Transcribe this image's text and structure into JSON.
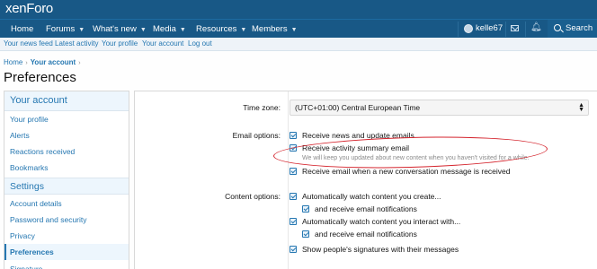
{
  "header": {
    "logo": "xenForo"
  },
  "nav": {
    "items": [
      {
        "label": "Home",
        "has_menu": false
      },
      {
        "label": "Forums",
        "has_menu": true
      },
      {
        "label": "What's new",
        "has_menu": true
      },
      {
        "label": "Media",
        "has_menu": true
      },
      {
        "label": "Resources",
        "has_menu": true
      },
      {
        "label": "Members",
        "has_menu": true
      }
    ],
    "username": "kelle67",
    "search_label": "Search"
  },
  "subnav": {
    "links": [
      "Your news feed",
      "Latest activity",
      "Your profile",
      "Your account",
      "Log out"
    ]
  },
  "breadcrumb": {
    "home": "Home",
    "current": "Your account"
  },
  "page_title": "Preferences",
  "sidebar": {
    "header": "Your account",
    "items": [
      "Your profile",
      "Alerts",
      "Reactions received",
      "Bookmarks"
    ],
    "group2": "Settings",
    "settings_items": [
      "Account details",
      "Password and security",
      "Privacy",
      "Preferences",
      "Signature"
    ],
    "active": "Preferences"
  },
  "form": {
    "timezone_label": "Time zone:",
    "timezone_value": "(UTC+01:00) Central European Time",
    "email_label": "Email options:",
    "email_options": [
      "Receive news and update emails",
      "Receive activity summary email",
      "Receive email when a new conversation message is received"
    ],
    "activity_hint": "We will keep you updated about new content when you haven't visited for a while.",
    "content_label": "Content options:",
    "content_options": [
      "Automatically watch content you create...",
      "and receive email notifications",
      "Automatically watch content you interact with...",
      "and receive email notifications",
      "Show people's signatures with their messages"
    ]
  },
  "colors": {
    "header_bg": "#185886",
    "link": "#2577b1",
    "annotation": "#d4232c"
  }
}
